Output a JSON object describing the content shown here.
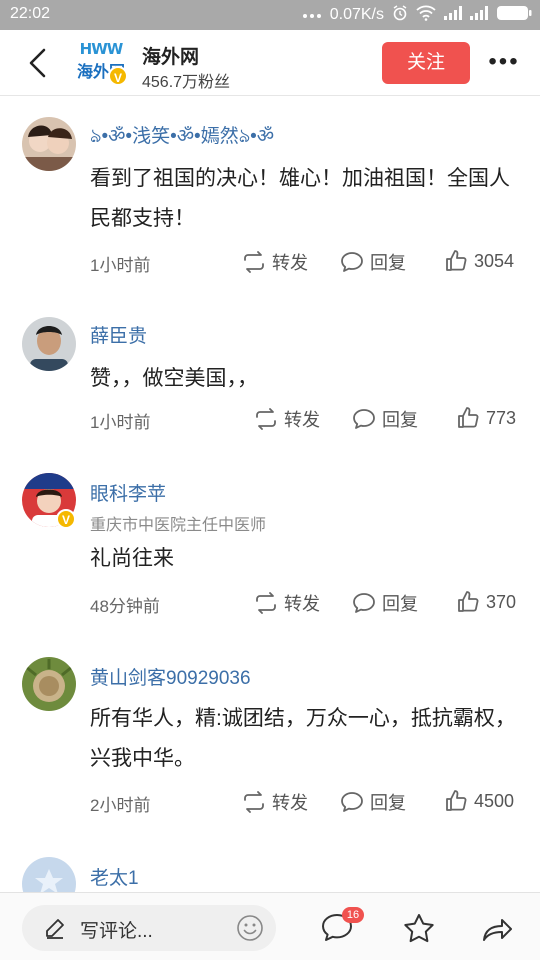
{
  "status_bar": {
    "time": "22:02",
    "net_speed": "0.07K/s",
    "icons": [
      "more-dots-icon",
      "alarm-icon",
      "wifi-icon",
      "signal-icon",
      "signal-icon",
      "battery-icon"
    ]
  },
  "header": {
    "account_name": "海外网",
    "fans": "456.7万粉丝",
    "follow_label": "关注",
    "more_label": "•••",
    "logo_top": "HWW",
    "logo_bottom": "海外网",
    "verified": "V"
  },
  "comments": [
    {
      "user": "ঌ•ॐ•浅笑•ॐ•嫣然ঌ•ॐ",
      "subtitle": "",
      "text": "看到了祖国的决心！雄心！加油祖国！全国人民都支持！",
      "time": "1小时前",
      "repost": "转发",
      "reply": "回复",
      "likes": "3054",
      "verified": ""
    },
    {
      "user": "薛臣贵",
      "subtitle": "",
      "text": "赞，，做空美国，，",
      "time": "1小时前",
      "repost": "转发",
      "reply": "回复",
      "likes": "773",
      "verified": ""
    },
    {
      "user": "眼科李苹",
      "subtitle": "重庆市中医院主任中医师",
      "text": "礼尚往来",
      "time": "48分钟前",
      "repost": "转发",
      "reply": "回复",
      "likes": "370",
      "verified": "V"
    },
    {
      "user": "黄山剑客90929036",
      "subtitle": "",
      "text": "所有华人，精:诚团结，万众一心，抵抗霸权，兴我中华。",
      "time": "2小时前",
      "repost": "转发",
      "reply": "回复",
      "likes": "4500",
      "verified": ""
    },
    {
      "user": "老太1",
      "subtitle": "",
      "text": "",
      "time": "",
      "repost": "",
      "reply": "",
      "likes": "",
      "verified": ""
    }
  ],
  "bottom_bar": {
    "placeholder": "写评论...",
    "comment_count": "16"
  },
  "colors": {
    "accent": "#f0524f",
    "username": "#3c6fa8",
    "status_bar": "#a9a9a9",
    "verified": "#f5b800"
  }
}
